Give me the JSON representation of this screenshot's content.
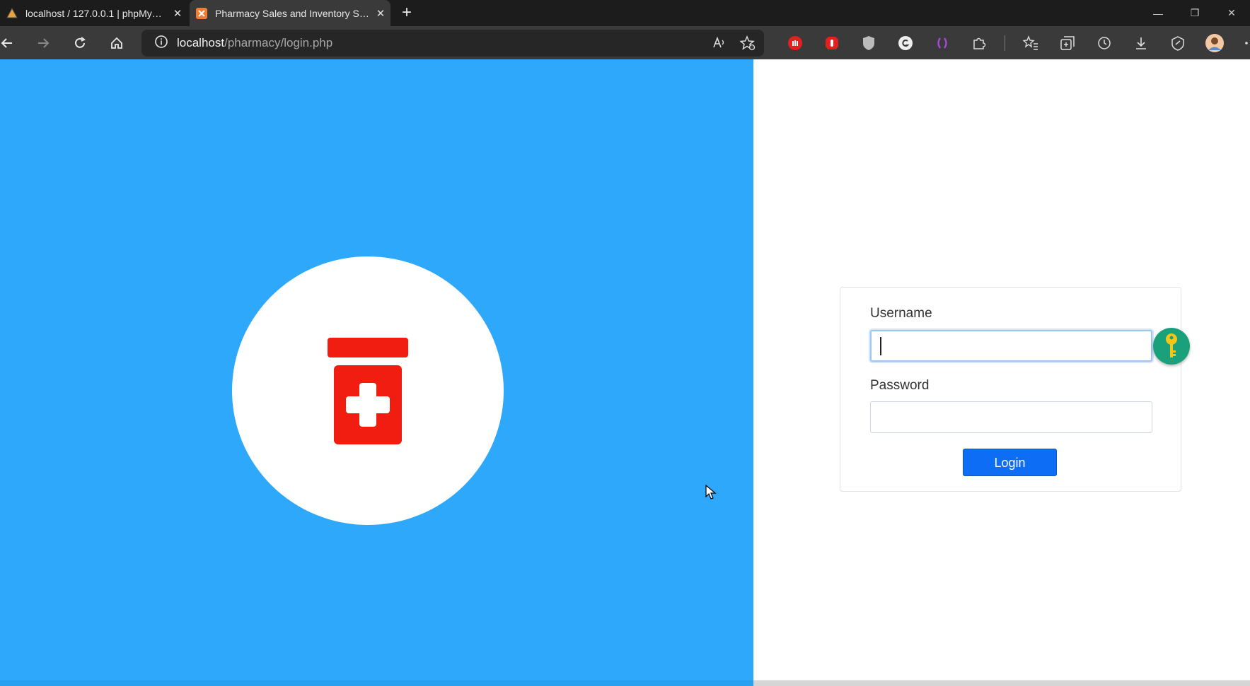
{
  "browser": {
    "tabs": [
      {
        "title": "localhost / 127.0.0.1 | phpMyAdmin",
        "icon": "phpmyadmin-icon",
        "active": false
      },
      {
        "title": "Pharmacy Sales and Inventory System",
        "icon": "xampp-icon",
        "active": true
      }
    ],
    "url_host": "localhost",
    "url_path": "/pharmacy/login.php"
  },
  "login": {
    "username_label": "Username",
    "username_value": "",
    "password_label": "Password",
    "password_value": "",
    "login_label": "Login"
  },
  "colors": {
    "left_panel": "#2ea8fb",
    "logo_red": "#f01d10",
    "button_blue": "#0d6ef5",
    "key_badge": "#1aa07a"
  }
}
